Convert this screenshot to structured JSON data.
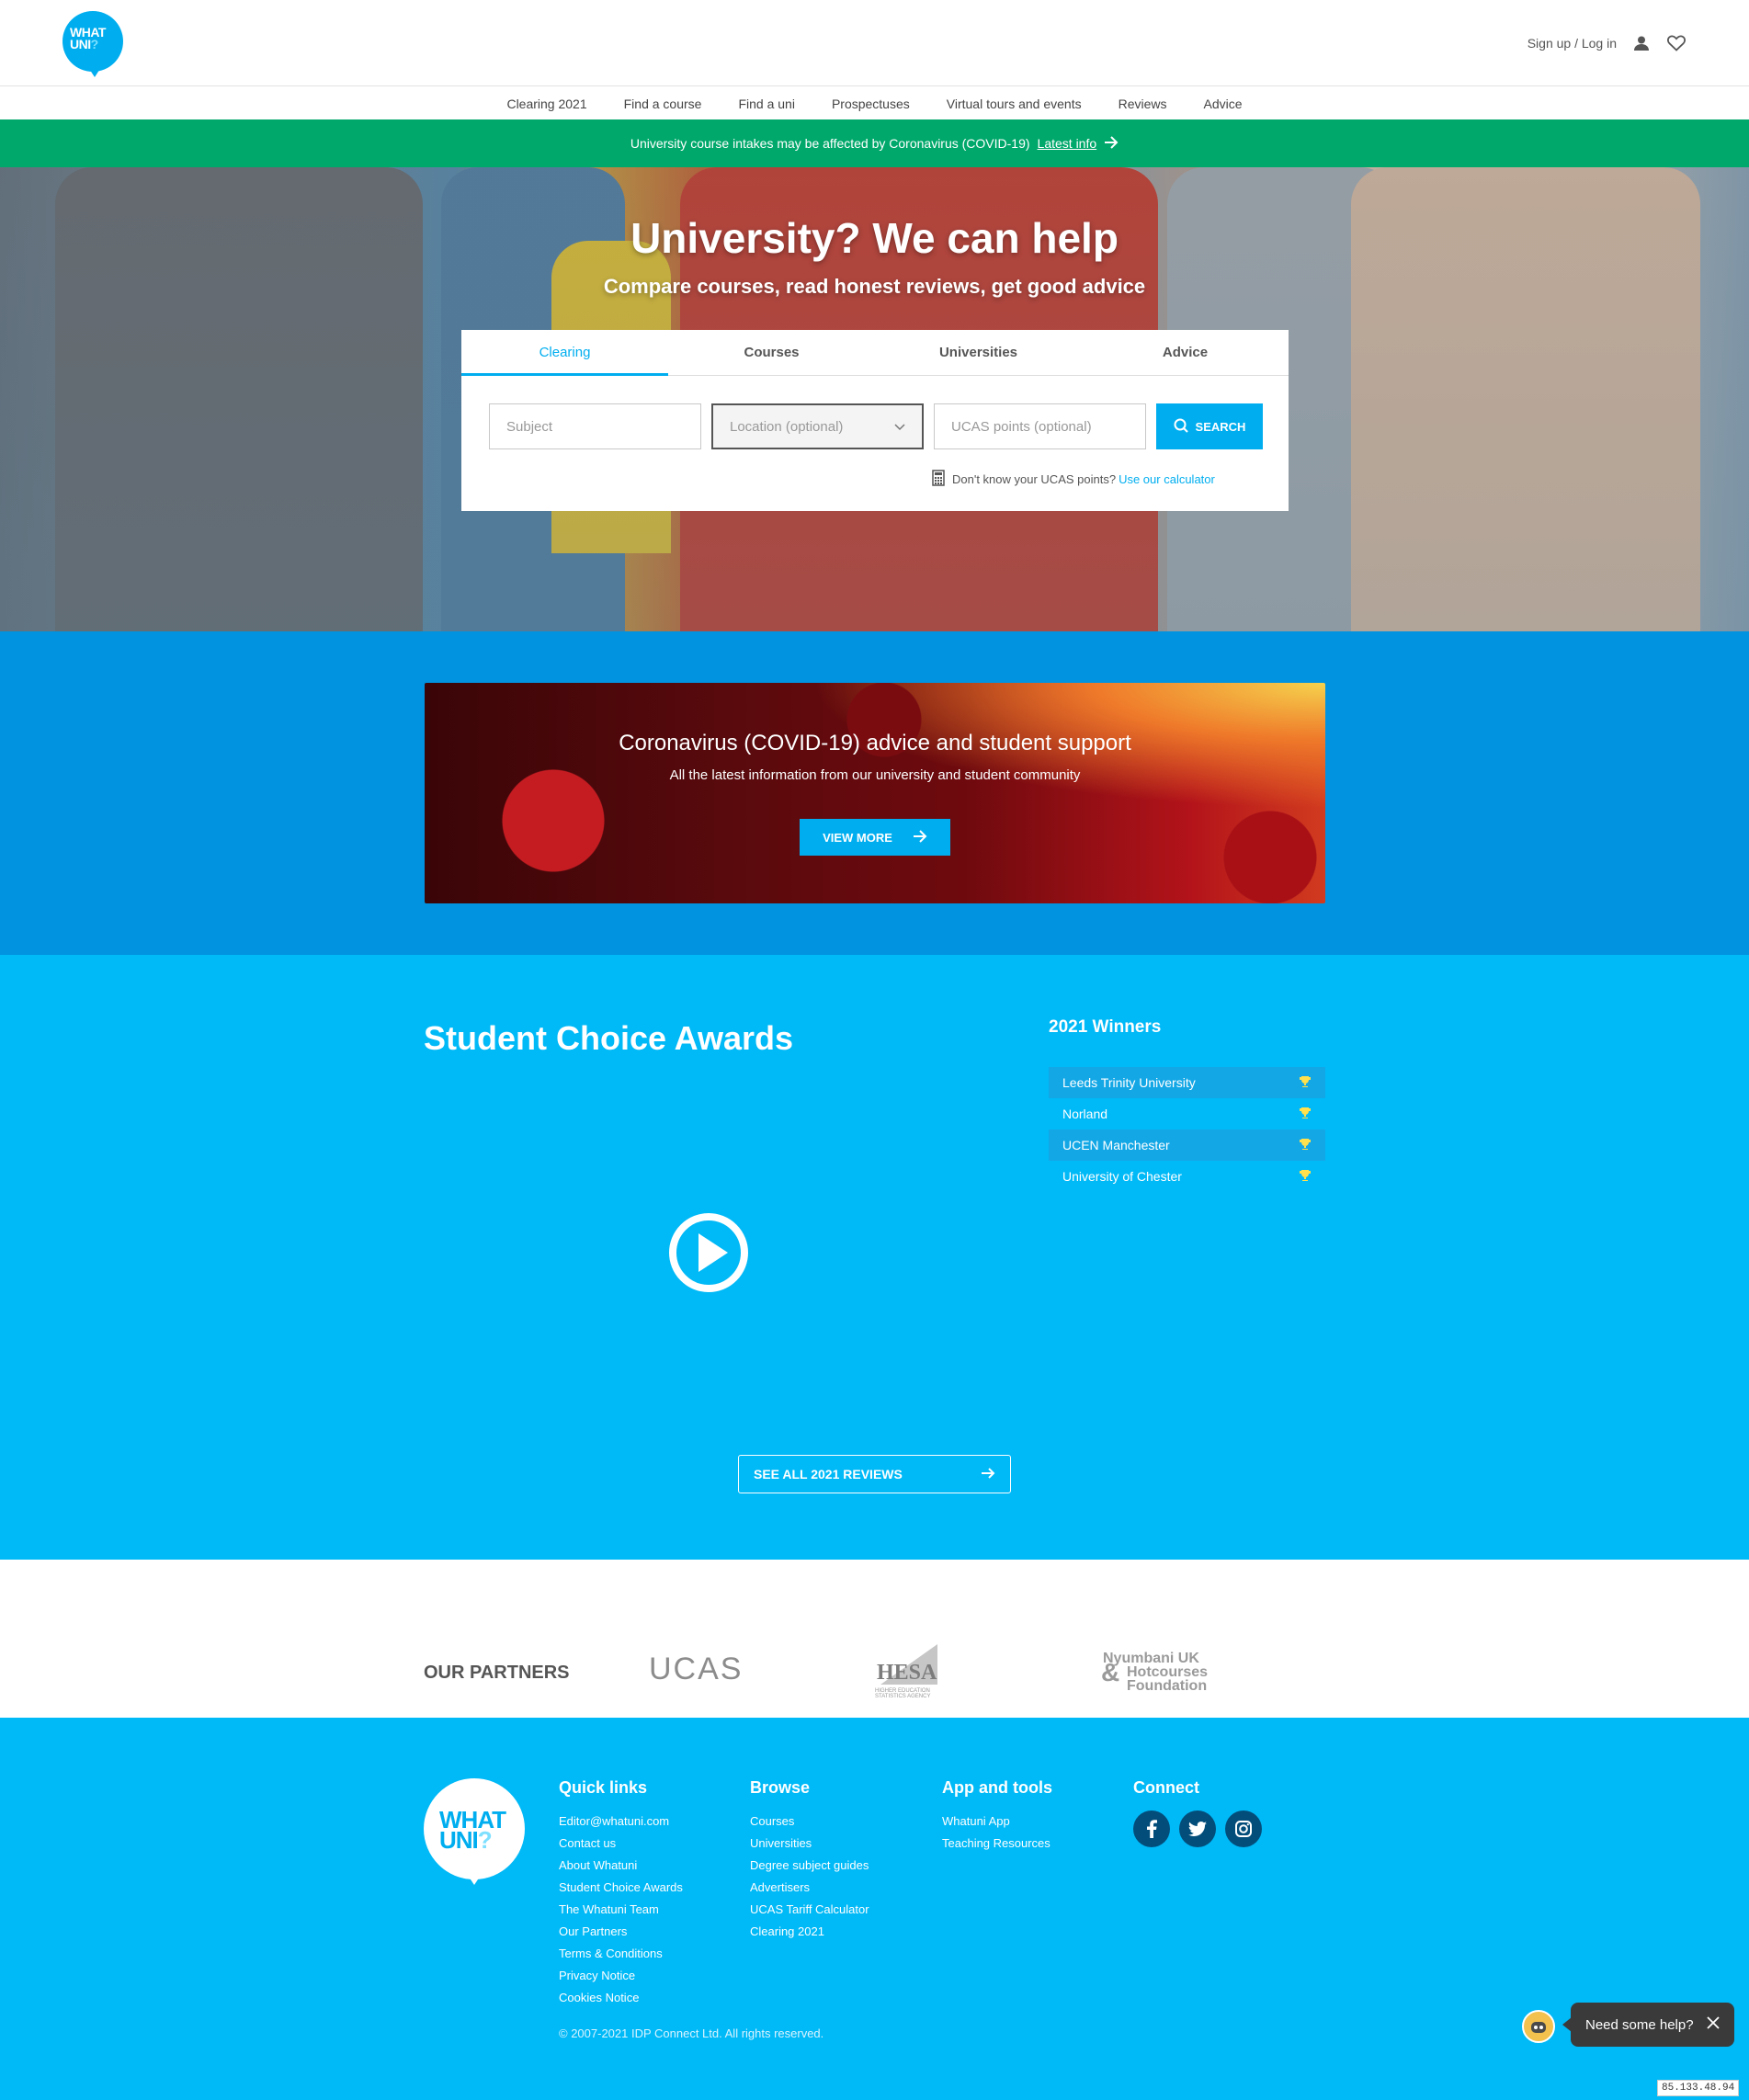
{
  "brand": {
    "logo_line1": "WHAT",
    "logo_line2": "UNI",
    "logo_q": "?",
    "accent": "#00aeef",
    "green": "#00a86b"
  },
  "header": {
    "signin": "Sign up / Log in",
    "user_icon": "user-icon",
    "favourites_icon": "heart-icon"
  },
  "nav": [
    "Clearing 2021",
    "Find a course",
    "Find a uni",
    "Prospectuses",
    "Virtual tours and events",
    "Reviews",
    "Advice"
  ],
  "covid_strip": {
    "text": "University course intakes may be affected by Coronavirus (COVID-19)",
    "link": "Latest info"
  },
  "hero": {
    "title": "University? We can help",
    "subtitle": "Compare courses, read honest reviews, get good advice",
    "tabs": [
      "Clearing",
      "Courses",
      "Universities",
      "Advice"
    ],
    "active_tab": "Clearing",
    "subject_placeholder": "Subject",
    "location_placeholder": "Location (optional)",
    "ucas_placeholder": "UCAS points (optional)",
    "search_label": "SEARCH",
    "calc_text": "Don't know your UCAS points?",
    "calc_link": "Use our calculator"
  },
  "promo": {
    "title": "Coronavirus (COVID-19) advice and student support",
    "subtitle": "All the latest information from our university and student community",
    "button": "VIEW MORE"
  },
  "awards": {
    "title": "Student Choice Awards",
    "winners_title": "2021 Winners",
    "winners": [
      "Leeds Trinity University",
      "Norland",
      "UCEN Manchester",
      "University of Chester"
    ],
    "reviews_button": "SEE ALL 2021 REVIEWS"
  },
  "partners": {
    "title": "OUR PARTNERS",
    "ucas": "UCAS",
    "hesa": "HESA",
    "hesa_tag": "HIGHER EDUCATION STATISTICS AGENCY",
    "nyumbani_l1": "Nyumbani UK",
    "nyumbani_amp": "&",
    "nyumbani_l2": "Hotcourses",
    "nyumbani_l3": "Foundation"
  },
  "footer": {
    "quick_title": "Quick links",
    "quick": [
      "Editor@whatuni.com",
      "Contact us",
      "About Whatuni",
      "Student Choice Awards",
      "The Whatuni Team",
      "Our Partners",
      "Terms & Conditions",
      "Privacy Notice",
      "Cookies Notice"
    ],
    "browse_title": "Browse",
    "browse": [
      "Courses",
      "Universities",
      "Degree subject guides",
      "Advertisers",
      "UCAS Tariff Calculator",
      "Clearing 2021"
    ],
    "app_title": "App and tools",
    "app": [
      "Whatuni App",
      "Teaching Resources"
    ],
    "connect_title": "Connect",
    "social": [
      "facebook-icon",
      "twitter-icon",
      "instagram-icon"
    ],
    "copyright": "© 2007-2021 IDP Connect Ltd. All rights reserved."
  },
  "help": {
    "label": "Need some help?"
  },
  "ip": "85.133.48.94"
}
